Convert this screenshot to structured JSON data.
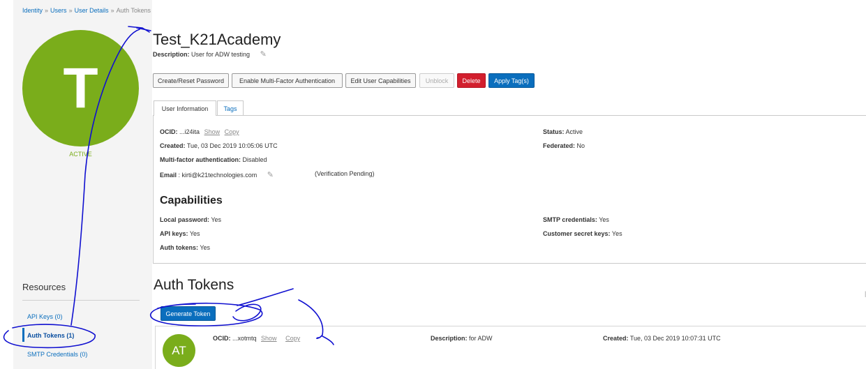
{
  "breadcrumb": {
    "items": [
      "Identity",
      "Users",
      "User Details"
    ],
    "current": "Auth Tokens",
    "separator": "»"
  },
  "user": {
    "initial": "T",
    "status": "ACTIVE",
    "name": "Test_K21Academy",
    "description_label": "Description:",
    "description_value": "User for ADW testing"
  },
  "actions": {
    "create_reset_password": "Create/Reset Password",
    "enable_mfa": "Enable Multi-Factor Authentication",
    "edit_capabilities": "Edit User Capabilities",
    "unblock": "Unblock",
    "delete": "Delete",
    "apply_tags": "Apply Tag(s)"
  },
  "tabs": {
    "user_information": "User Information",
    "tags": "Tags"
  },
  "info": {
    "ocid_label": "OCID:",
    "ocid_value": "...i24ita",
    "show": "Show",
    "copy": "Copy",
    "created_label": "Created:",
    "created_value": "Tue, 03 Dec 2019 10:05:06 UTC",
    "mfa_label": "Multi-factor authentication:",
    "mfa_value": "Disabled",
    "email_label": "Email",
    "email_value": ": kirti@k21technologies.com",
    "email_note": "(Verification Pending)",
    "status_label": "Status:",
    "status_value": "Active",
    "federated_label": "Federated:",
    "federated_value": "No"
  },
  "capabilities": {
    "title": "Capabilities",
    "local_password_label": "Local password:",
    "local_password_value": "Yes",
    "api_keys_label": "API keys:",
    "api_keys_value": "Yes",
    "auth_tokens_label": "Auth tokens:",
    "auth_tokens_value": "Yes",
    "smtp_label": "SMTP credentials:",
    "smtp_value": "Yes",
    "customer_secret_label": "Customer secret keys:",
    "customer_secret_value": "Yes"
  },
  "resources": {
    "title": "Resources",
    "items": [
      "API Keys (0)",
      "Auth Tokens (1)",
      "SMTP Credentials (0)"
    ]
  },
  "auth_tokens": {
    "title": "Auth Tokens",
    "generate_button": "Generate Token",
    "token": {
      "avatar": "AT",
      "ocid_label": "OCID:",
      "ocid_value": "...xotmtq",
      "show": "Show",
      "copy": "Copy",
      "description_label": "Description:",
      "description_value": "for ADW",
      "created_label": "Created:",
      "created_value": "Tue, 03 Dec 2019 10:07:31 UTC"
    }
  },
  "colors": {
    "accent_blue": "#0a6ebd",
    "avatar_green": "#7aad1b",
    "danger_red": "#d21f2e",
    "annotation_ink": "#1010d0"
  },
  "icons": {
    "edit": "pencil-icon"
  }
}
